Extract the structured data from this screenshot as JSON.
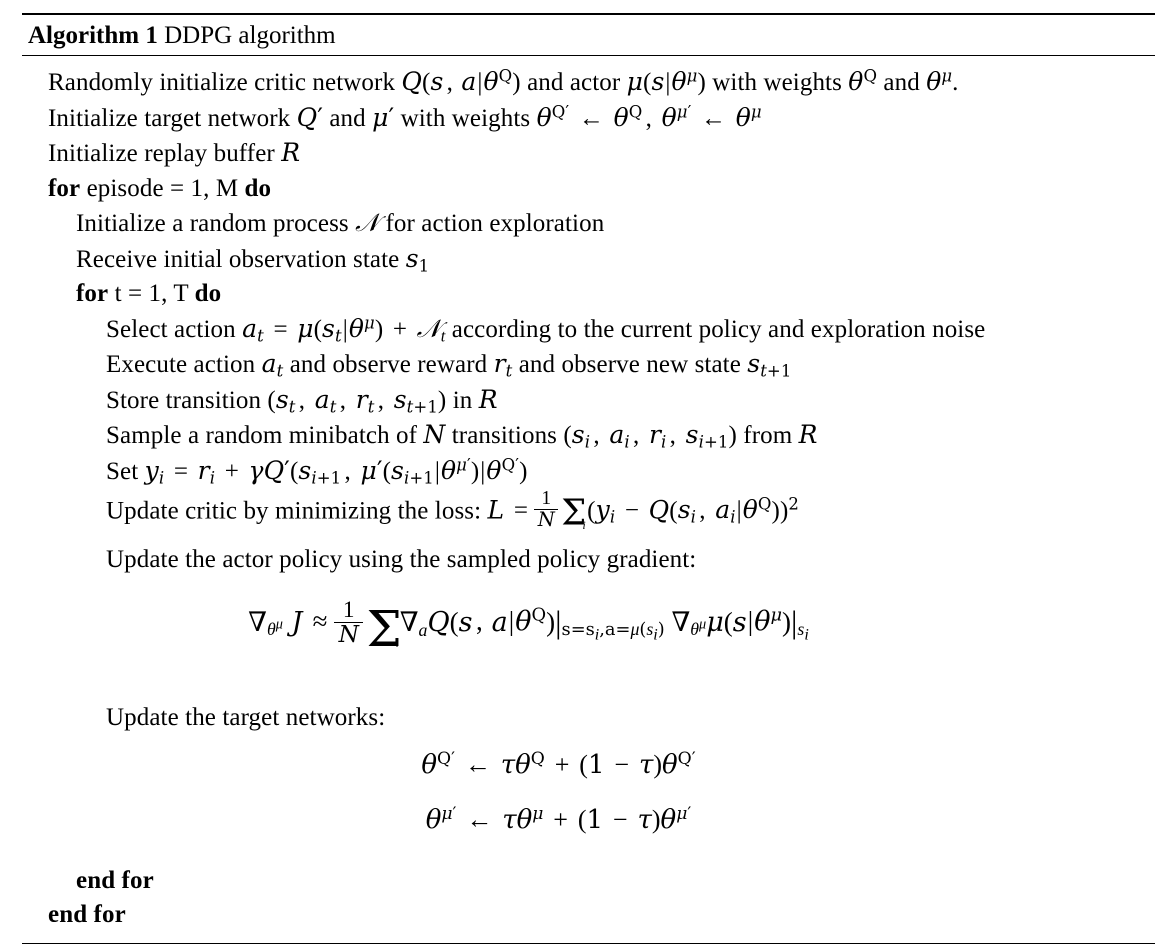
{
  "algorithm": {
    "label": "Algorithm 1",
    "title": "DDPG algorithm",
    "lines": [
      {
        "id": "l1",
        "indent": 0,
        "text": "Randomly initialize critic network Q(s, a|θ^Q) and actor μ(s|θ^μ) with weights θ^Q and θ^μ."
      },
      {
        "id": "l2",
        "indent": 0,
        "text": "Initialize target network Q′ and μ′ with weights θ^{Q′} ← θ^Q, θ^{μ′} ← θ^μ"
      },
      {
        "id": "l3",
        "indent": 0,
        "text": "Initialize replay buffer R"
      },
      {
        "id": "l4",
        "indent": 0,
        "text": "for episode = 1, M do",
        "keywords": [
          "for",
          "do"
        ]
      },
      {
        "id": "l5",
        "indent": 1,
        "text": "Initialize a random process 𝒩 for action exploration"
      },
      {
        "id": "l6",
        "indent": 1,
        "text": "Receive initial observation state s_1"
      },
      {
        "id": "l7",
        "indent": 1,
        "text": "for t = 1, T do",
        "keywords": [
          "for",
          "do"
        ]
      },
      {
        "id": "l8",
        "indent": 2,
        "text": "Select action a_t = μ(s_t|θ^μ) + 𝒩_t according to the current policy and exploration noise"
      },
      {
        "id": "l9",
        "indent": 2,
        "text": "Execute action a_t and observe reward r_t and observe new state s_{t+1}"
      },
      {
        "id": "l10",
        "indent": 2,
        "text": "Store transition (s_t, a_t, r_t, s_{t+1}) in R"
      },
      {
        "id": "l11",
        "indent": 2,
        "text": "Sample a random minibatch of N transitions (s_i, a_i, r_i, s_{i+1}) from R"
      },
      {
        "id": "l12",
        "indent": 2,
        "text": "Set y_i = r_i + γQ′(s_{i+1}, μ′(s_{i+1}|θ^{μ′})|θ^{Q′})"
      },
      {
        "id": "l13",
        "indent": 2,
        "text": "Update critic by minimizing the loss: L = (1/N) Σ_i (y_i − Q(s_i, a_i|θ^Q))^2"
      },
      {
        "id": "l14",
        "indent": 2,
        "text": "Update the actor policy using the sampled policy gradient:"
      },
      {
        "id": "l15",
        "indent": 2,
        "text": "Update the target networks:"
      },
      {
        "id": "l16",
        "indent": 1,
        "text": "end for",
        "keywords": [
          "end for"
        ]
      },
      {
        "id": "l17",
        "indent": 0,
        "text": "end for",
        "keywords": [
          "end for"
        ]
      }
    ],
    "equations": {
      "policy_gradient": "∇_{θ^μ} J ≈ (1/N) Σ_i ∇_a Q(s, a|θ^Q)|_{s=s_i, a=μ(s_i)} ∇_{θ^μ} μ(s|θ^μ)|_{s_i}",
      "target_critic": "θ^{Q′} ← τθ^Q + (1 − τ)θ^{Q′}",
      "target_actor": "θ^{μ′} ← τθ^μ + (1 − τ)θ^{μ′}"
    },
    "symbols": {
      "theta": "θ",
      "mu": "μ",
      "gamma": "γ",
      "tau": "τ",
      "nabla": "∇",
      "sum": "Σ",
      "approx": "≈",
      "leftarrow": "←",
      "script_n": "𝒩",
      "prime": "′"
    },
    "colors": {
      "text": "#000000",
      "background": "#ffffff",
      "rule": "#000000"
    }
  }
}
